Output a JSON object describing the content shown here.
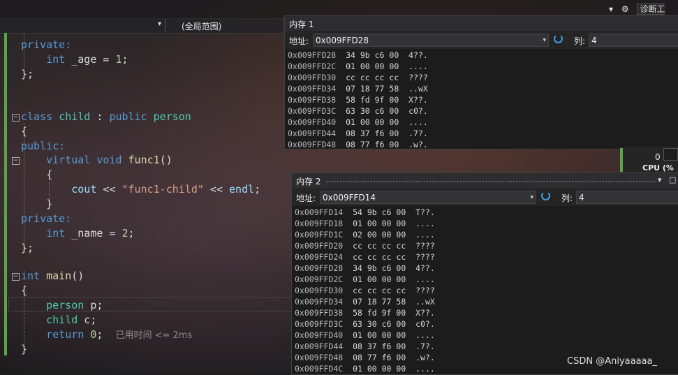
{
  "window": {
    "top_right_label": "诊断工具"
  },
  "navbar": {
    "scope_label": "(全局范围)"
  },
  "code": {
    "lines": [
      "private:",
      "    int _age = 1;",
      "};",
      "class child : public person",
      "{",
      "public:",
      "    virtual void func1()",
      "    {",
      "        cout << \"func1-child\" << endl;",
      "    }",
      "private:",
      "    int _name = 2;",
      "};",
      "int main()",
      "{",
      "    person p;",
      "    child c;",
      "    return 0;",
      "}"
    ],
    "perf_tip": "已用时间 <= 2ms"
  },
  "memory1": {
    "title": "内存 1",
    "address_label": "地址:",
    "address_value": "0x009FFD28",
    "columns_label": "列:",
    "columns_value": "4",
    "rows": [
      {
        "addr": "0x009FFD28",
        "bytes": "34 9b c6 00",
        "ascii": "4??."
      },
      {
        "addr": "0x009FFD2C",
        "bytes": "01 00 00 00",
        "ascii": "...."
      },
      {
        "addr": "0x009FFD30",
        "bytes": "cc cc cc cc",
        "ascii": "????"
      },
      {
        "addr": "0x009FFD34",
        "bytes": "07 18 77 58",
        "ascii": "..wX"
      },
      {
        "addr": "0x009FFD38",
        "bytes": "58 fd 9f 00",
        "ascii": "X??."
      },
      {
        "addr": "0x009FFD3C",
        "bytes": "63 30 c6 00",
        "ascii": "c0?."
      },
      {
        "addr": "0x009FFD40",
        "bytes": "01 00 00 00",
        "ascii": "...."
      },
      {
        "addr": "0x009FFD44",
        "bytes": "08 37 f6 00",
        "ascii": ".7?."
      },
      {
        "addr": "0x009FFD48",
        "bytes": "08 77 f6 00",
        "ascii": ".w?."
      }
    ]
  },
  "memory2": {
    "title": "内存 2",
    "address_label": "地址:",
    "address_value": "0x009FFD14",
    "columns_label": "列:",
    "columns_value": "4",
    "rows": [
      {
        "addr": "0x009FFD14",
        "bytes": "54 9b c6 00",
        "ascii": "T??."
      },
      {
        "addr": "0x009FFD18",
        "bytes": "01 00 00 00",
        "ascii": "...."
      },
      {
        "addr": "0x009FFD1C",
        "bytes": "02 00 00 00",
        "ascii": "...."
      },
      {
        "addr": "0x009FFD20",
        "bytes": "cc cc cc cc",
        "ascii": "????"
      },
      {
        "addr": "0x009FFD24",
        "bytes": "cc cc cc cc",
        "ascii": "????"
      },
      {
        "addr": "0x009FFD28",
        "bytes": "34 9b c6 00",
        "ascii": "4??."
      },
      {
        "addr": "0x009FFD2C",
        "bytes": "01 00 00 00",
        "ascii": "...."
      },
      {
        "addr": "0x009FFD30",
        "bytes": "cc cc cc cc",
        "ascii": "????"
      },
      {
        "addr": "0x009FFD34",
        "bytes": "07 18 77 58",
        "ascii": "..wX"
      },
      {
        "addr": "0x009FFD38",
        "bytes": "58 fd 9f 00",
        "ascii": "X??."
      },
      {
        "addr": "0x009FFD3C",
        "bytes": "63 30 c6 00",
        "ascii": "c0?."
      },
      {
        "addr": "0x009FFD40",
        "bytes": "01 00 00 00",
        "ascii": "...."
      },
      {
        "addr": "0x009FFD44",
        "bytes": "08 37 f6 00",
        "ascii": ".7?."
      },
      {
        "addr": "0x009FFD48",
        "bytes": "08 77 f6 00",
        "ascii": ".w?."
      },
      {
        "addr": "0x009FFD4C",
        "bytes": "01 00 00 00",
        "ascii": "...."
      }
    ]
  },
  "cpu": {
    "value": "0",
    "label": "CPU (%"
  },
  "watermark": "CSDN @Aniyaaaaa_",
  "colors": {
    "keyword": "#569cd6",
    "type": "#4ec9b0",
    "function": "#dcdcaa",
    "string": "#d69d85",
    "number": "#b5cea8",
    "change_bar": "#57a64a",
    "refresh_icon": "#3f9fe0"
  }
}
